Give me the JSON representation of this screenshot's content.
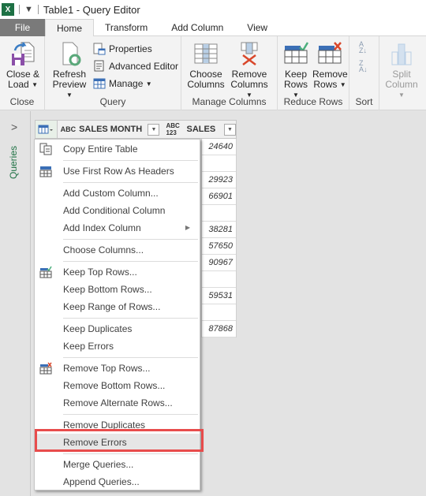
{
  "titlebar": {
    "app_icon": "excel-icon",
    "qat_icon": "customize-qat-icon",
    "title": "Table1 - Query Editor"
  },
  "tabs": [
    {
      "label": "File"
    },
    {
      "label": "Home",
      "active": true
    },
    {
      "label": "Transform"
    },
    {
      "label": "Add Column"
    },
    {
      "label": "View"
    }
  ],
  "ribbon": {
    "groups": {
      "close": {
        "label": "Close",
        "close_load": {
          "line1": "Close &",
          "line2": "Load"
        }
      },
      "query": {
        "label": "Query",
        "refresh": {
          "line1": "Refresh",
          "line2": "Preview"
        },
        "properties": "Properties",
        "advanced_editor": "Advanced Editor",
        "manage": "Manage"
      },
      "manage_columns": {
        "label": "Manage Columns",
        "choose": {
          "line1": "Choose",
          "line2": "Columns"
        },
        "remove": {
          "line1": "Remove",
          "line2": "Columns"
        }
      },
      "reduce_rows": {
        "label": "Reduce Rows",
        "keep": {
          "line1": "Keep",
          "line2": "Rows"
        },
        "remove": {
          "line1": "Remove",
          "line2": "Rows"
        }
      },
      "sort": {
        "label": "Sort",
        "asc_icon": "sort-ascending-icon",
        "desc_icon": "sort-descending-icon"
      },
      "split": {
        "line1": "Split",
        "line2": "Column",
        "disabled": true
      }
    }
  },
  "queries_pane": {
    "label": "Queries",
    "toggle": ">"
  },
  "grid": {
    "columns": [
      {
        "type": "ABC",
        "name": "SALES MONTH"
      },
      {
        "type": "ABC 123",
        "name": "SALES"
      }
    ],
    "sales_values": [
      "24640",
      "",
      "29923",
      "66901",
      "",
      "38281",
      "57650",
      "90967",
      "",
      "59531",
      "",
      "87868"
    ]
  },
  "context_menu": {
    "items": [
      {
        "label": "Copy Entire Table",
        "icon": "copy-table-icon"
      },
      {
        "label": "Use First Row As Headers",
        "icon": "first-row-headers-icon"
      },
      {
        "label": "Add Custom Column..."
      },
      {
        "label": "Add Conditional Column"
      },
      {
        "label": "Add Index Column",
        "submenu": true
      },
      {
        "label": "Choose Columns..."
      },
      {
        "label": "Keep Top Rows...",
        "icon": "keep-rows-icon"
      },
      {
        "label": "Keep Bottom Rows..."
      },
      {
        "label": "Keep Range of Rows..."
      },
      {
        "label": "Keep Duplicates"
      },
      {
        "label": "Keep Errors"
      },
      {
        "label": "Remove Top Rows...",
        "icon": "remove-rows-icon"
      },
      {
        "label": "Remove Bottom Rows..."
      },
      {
        "label": "Remove Alternate Rows..."
      },
      {
        "label": "Remove Duplicates"
      },
      {
        "label": "Remove Errors",
        "highlighted": true
      },
      {
        "label": "Merge Queries..."
      },
      {
        "label": "Append Queries..."
      }
    ]
  },
  "colors": {
    "highlight_border": "#e84c4c",
    "excel_green": "#217346",
    "file_tab": "#7a7a7a"
  }
}
